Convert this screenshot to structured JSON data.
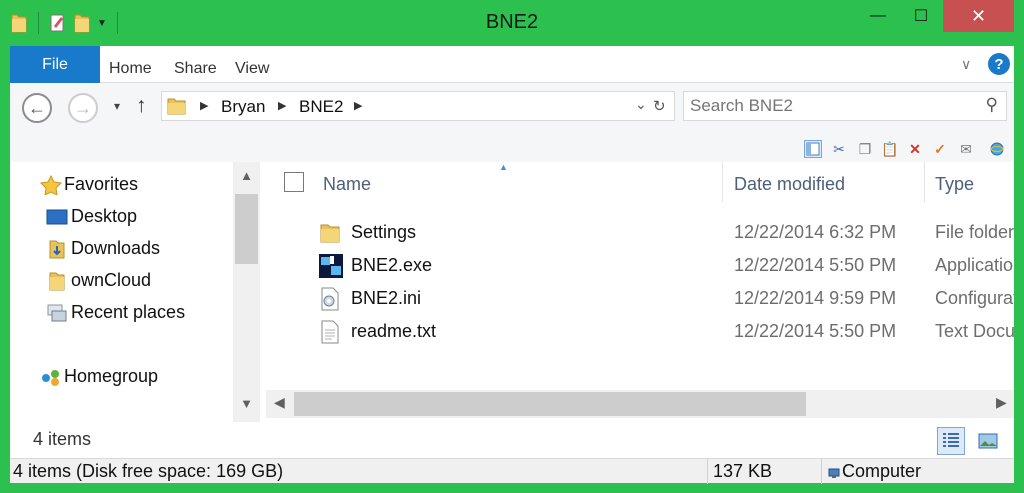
{
  "window": {
    "title": "BNE2",
    "min_label": "—",
    "max_label": "☐",
    "close_label": "✕"
  },
  "ribbon": {
    "file": "File",
    "tabs": [
      "Home",
      "Share",
      "View"
    ],
    "expand": "∨",
    "help": "?"
  },
  "nav": {
    "back": "←",
    "forward": "→",
    "recent": "▾",
    "up": "↑"
  },
  "address": {
    "crumbs": [
      "Bryan",
      "BNE2"
    ],
    "dropdown": "⌄",
    "refresh": "↻"
  },
  "search": {
    "placeholder": "Search BNE2",
    "icon": "⚲"
  },
  "sidebar": {
    "items": [
      {
        "label": "Favorites",
        "icon": "star-icon"
      },
      {
        "label": "Desktop",
        "icon": "desktop-icon"
      },
      {
        "label": "Downloads",
        "icon": "downloads-icon"
      },
      {
        "label": "ownCloud",
        "icon": "folder-icon"
      },
      {
        "label": "Recent places",
        "icon": "recent-places-icon"
      },
      {
        "label": "Homegroup",
        "icon": "homegroup-icon"
      }
    ]
  },
  "columns": {
    "name": "Name",
    "date": "Date modified",
    "type": "Type"
  },
  "files": [
    {
      "name": "Settings",
      "date": "12/22/2014 6:32 PM",
      "type": "File folder",
      "icon": "folder-icon"
    },
    {
      "name": "BNE2.exe",
      "date": "12/22/2014 5:50 PM",
      "type": "Application",
      "icon": "exe-icon"
    },
    {
      "name": "BNE2.ini",
      "date": "12/22/2014 9:59 PM",
      "type": "Configuration settings",
      "icon": "ini-icon"
    },
    {
      "name": "readme.txt",
      "date": "12/22/2014 5:50 PM",
      "type": "Text Document",
      "icon": "txt-icon"
    }
  ],
  "status": {
    "item_count": "4 items"
  },
  "bottom": {
    "info": "4 items (Disk free space: 169 GB)",
    "size": "137 KB",
    "location": "Computer"
  },
  "colors": {
    "frame": "#2cc04f",
    "file_tab": "#1979ca",
    "close": "#c75050"
  }
}
